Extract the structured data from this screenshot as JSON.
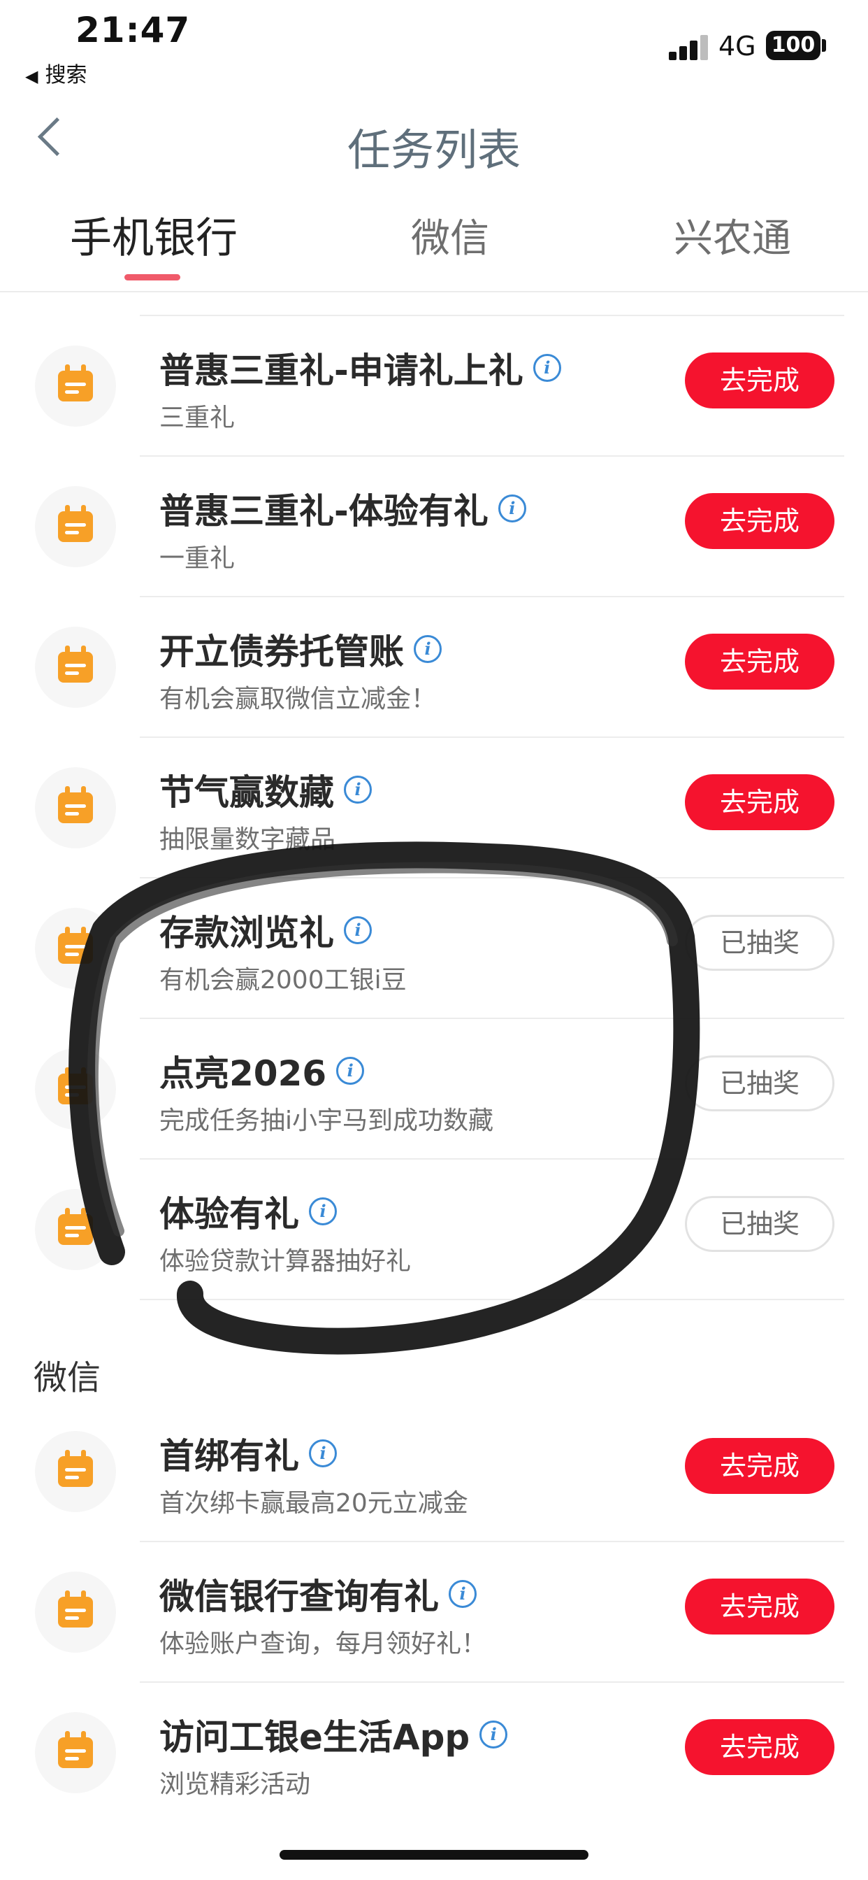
{
  "status_bar": {
    "time": "21:47",
    "back_app": "搜索",
    "network": "4G",
    "battery": "100"
  },
  "nav": {
    "title": "任务列表"
  },
  "tabs": [
    {
      "label": "手机银行",
      "active": true
    },
    {
      "label": "微信",
      "active": false
    },
    {
      "label": "兴农通",
      "active": false
    }
  ],
  "tasks": [
    {
      "title": "普惠三重礼-申请礼上礼",
      "subtitle": "三重礼",
      "button": "去完成",
      "state": "todo"
    },
    {
      "title": "普惠三重礼-体验有礼",
      "subtitle": "一重礼",
      "button": "去完成",
      "state": "todo"
    },
    {
      "title": "开立债券托管账",
      "subtitle": "有机会赢取微信立减金！",
      "button": "去完成",
      "state": "todo"
    },
    {
      "title": "节气赢数藏",
      "subtitle": "抽限量数字藏品",
      "button": "去完成",
      "state": "todo"
    },
    {
      "title": "存款浏览礼",
      "subtitle": "有机会赢2000工银i豆",
      "button": "已抽奖",
      "state": "done"
    },
    {
      "title": "点亮2026",
      "subtitle": "完成任务抽i小宇马到成功数藏",
      "button": "已抽奖",
      "state": "done"
    },
    {
      "title": "体验有礼",
      "subtitle": "体验贷款计算器抽好礼",
      "button": "已抽奖",
      "state": "done"
    }
  ],
  "wechat_section": {
    "title": "微信",
    "tasks": [
      {
        "title": "首绑有礼",
        "subtitle": "首次绑卡赢最高20元立减金",
        "button": "去完成"
      },
      {
        "title": "微信银行查询有礼",
        "subtitle": "体验账户查询，每月领好礼！",
        "button": "去完成"
      },
      {
        "title": "访问工银e生活App",
        "subtitle": "浏览精彩活动",
        "button": "去完成"
      }
    ]
  },
  "icons": {
    "task": "calendar-icon",
    "info": "info-icon",
    "back": "chevron-left-icon"
  },
  "colors": {
    "primary_button": "#f5132e",
    "tab_indicator": "#f05a6a",
    "task_icon": "#f7a027",
    "info_icon": "#3a8ad6"
  },
  "info_glyph": "i"
}
